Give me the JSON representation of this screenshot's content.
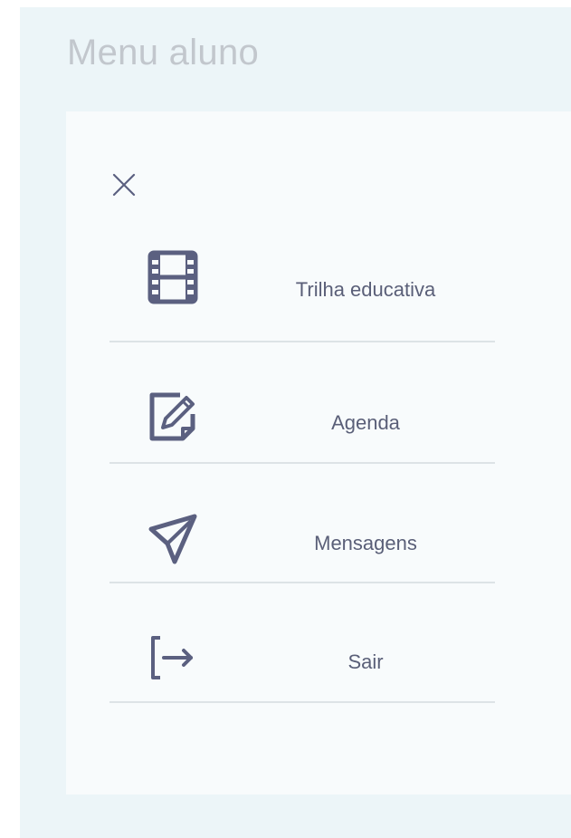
{
  "page": {
    "title": "Menu aluno"
  },
  "menu": {
    "close_icon": "close-icon",
    "items": [
      {
        "label": "Trilha educativa",
        "icon": "film-icon"
      },
      {
        "label": "Agenda",
        "icon": "edit-icon"
      },
      {
        "label": "Mensagens",
        "icon": "send-icon"
      },
      {
        "label": "Sair",
        "icon": "logout-icon"
      }
    ]
  },
  "colors": {
    "background": "#ecf5f8",
    "panel": "#f8fbfc",
    "title": "#c2c7cd",
    "icon": "#5b6080",
    "label": "#5a5f78",
    "divider": "#dde3e6"
  }
}
